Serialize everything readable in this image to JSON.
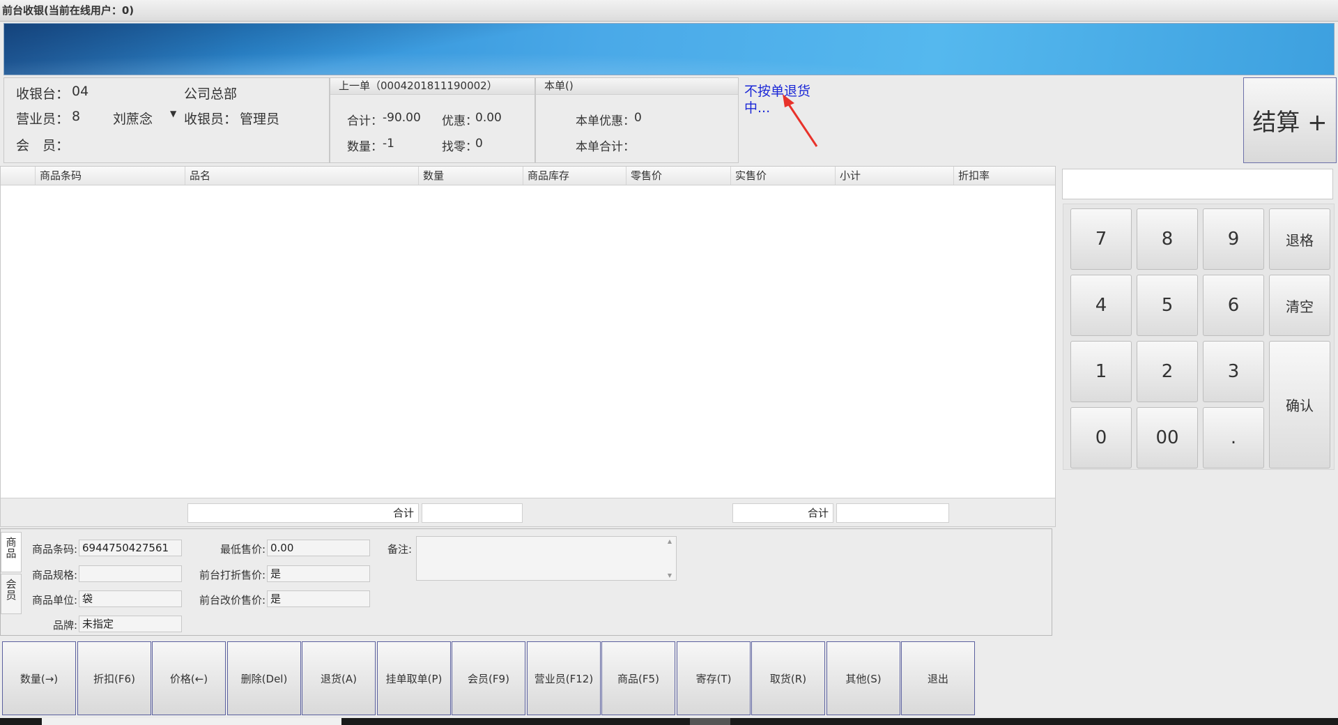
{
  "window": {
    "title": "前台收银(当前在线用户：0)"
  },
  "info": {
    "register_label": "收银台：",
    "register_value": "04",
    "company": "公司总部",
    "salesperson_label": "营业员：",
    "salesperson_id": "8",
    "salesperson_name": "刘蔗念",
    "cashier_label": "收银员：",
    "cashier_value": "管理员",
    "member_label": "会　员："
  },
  "prev_order": {
    "header": "上一单（0004201811190002）",
    "total_label": "合计：",
    "total_value": "-90.00",
    "discount_label": "优惠：",
    "discount_value": "0.00",
    "qty_label": "数量：",
    "qty_value": "-1",
    "change_label": "找零：",
    "change_value": "0"
  },
  "this_order": {
    "header": "本单()",
    "discount_label": "本单优惠：",
    "discount_value": "0",
    "total_label": "本单合计：",
    "total_value": ""
  },
  "notice": "不按单退货中...",
  "checkout": {
    "label": "结算 +"
  },
  "table": {
    "columns": [
      "商品条码",
      "品名",
      "数量",
      "商品库存",
      "零售价",
      "实售价",
      "小计",
      "折扣率"
    ],
    "footer_label_1": "合计",
    "footer_label_2": "合计"
  },
  "keypad": {
    "keys": [
      "7",
      "8",
      "9",
      "退格",
      "4",
      "5",
      "6",
      "清空",
      "1",
      "2",
      "3",
      "确认",
      "0",
      "00",
      "."
    ]
  },
  "details": {
    "tab_1": "商品",
    "tab_2": "会员",
    "barcode_label": "商品条码:",
    "barcode_value": "6944750427561",
    "spec_label": "商品规格:",
    "spec_value": "",
    "unit_label": "商品单位:",
    "unit_value": "袋",
    "brand_label": "品牌:",
    "brand_value": "未指定",
    "min_price_label": "最低售价:",
    "min_price_value": "0.00",
    "discount_price_label": "前台打折售价:",
    "discount_price_value": "是",
    "change_price_label": "前台改价售价:",
    "change_price_value": "是",
    "remark_label": "备注:"
  },
  "toolbar": {
    "buttons": [
      "数量(→)",
      "折扣(F6)",
      "价格(←)",
      "删除(Del)",
      "退货(A)",
      "挂单取单(P)",
      "会员(F9)",
      "营业员(F12)",
      "商品(F5)",
      "寄存(T)",
      "取货(R)",
      "其他(S)",
      "退出"
    ]
  },
  "colors": {
    "notice": "#1a27d6",
    "banner": "#3a9be0",
    "button_border": "#5a5f9e"
  }
}
